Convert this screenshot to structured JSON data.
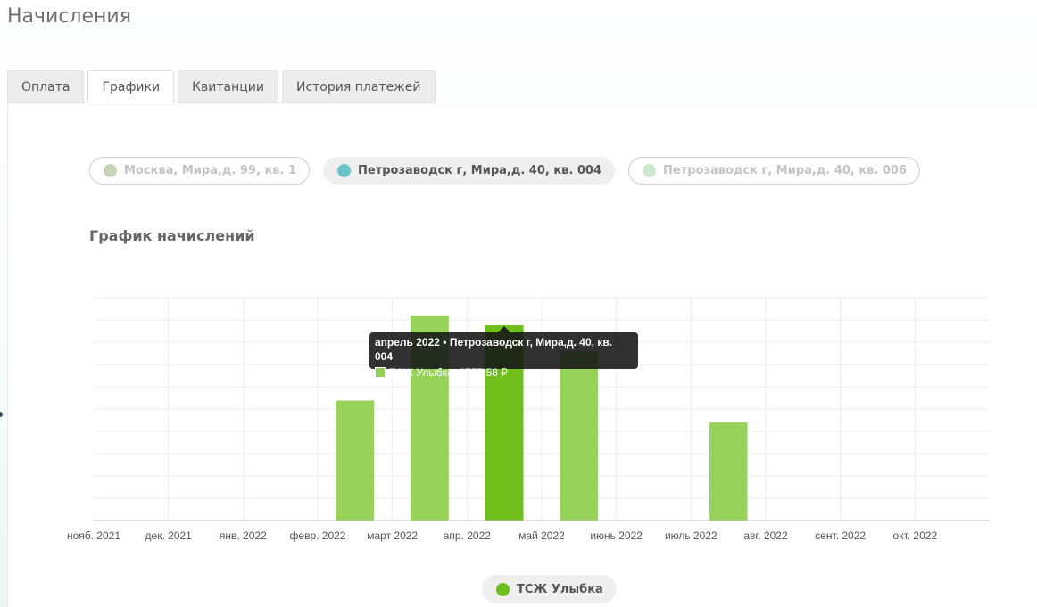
{
  "page": {
    "title": "Начисления"
  },
  "tabs": [
    {
      "label": "Оплата",
      "active": false
    },
    {
      "label": "Графики",
      "active": true
    },
    {
      "label": "Квитанции",
      "active": false
    },
    {
      "label": "История платежей",
      "active": false
    }
  ],
  "addresses": [
    {
      "label": "Москва, Мира,д. 99, кв. 1",
      "color": "#c6d4b9",
      "active": false
    },
    {
      "label": "Петрозаводск г, Мира,д. 40, кв. 004",
      "color": "#6cc3c8",
      "active": true
    },
    {
      "label": "Петрозаводск г, Мира,д. 40, кв. 006",
      "color": "#cfe6cf",
      "active": false
    }
  ],
  "chart_title": "График начислений",
  "chart_data": {
    "type": "bar",
    "categories": [
      "нояб. 2021",
      "дек. 2021",
      "янв. 2022",
      "февр. 2022",
      "март 2022",
      "апр. 2022",
      "май 2022",
      "июнь 2022",
      "июль 2022",
      "авг. 2022",
      "сент. 2022",
      "окт. 2022"
    ],
    "series": [
      {
        "name": "ТСЖ Улыбка",
        "values": [
          0,
          0,
          0,
          5380,
          9200,
          8757.58,
          7600,
          0,
          4400,
          0,
          0,
          0
        ]
      }
    ],
    "ylim": [
      0,
      10000
    ],
    "highlight_index": 5,
    "colors": {
      "bar": "#97d35b",
      "bar_highlight": "#6fbe1b",
      "grid": "#ececec",
      "axis": "#bfbfbf"
    },
    "grid": true,
    "legend_position": "bottom"
  },
  "tooltip": {
    "header": "апрель 2022 • Петрозаводск г, Мира,д. 40, кв. 004",
    "line": "ТСЖ Улыбка: 8757.58 ₽"
  },
  "legend": {
    "label": "ТСЖ Улыбка",
    "color": "#6fbe1b"
  }
}
